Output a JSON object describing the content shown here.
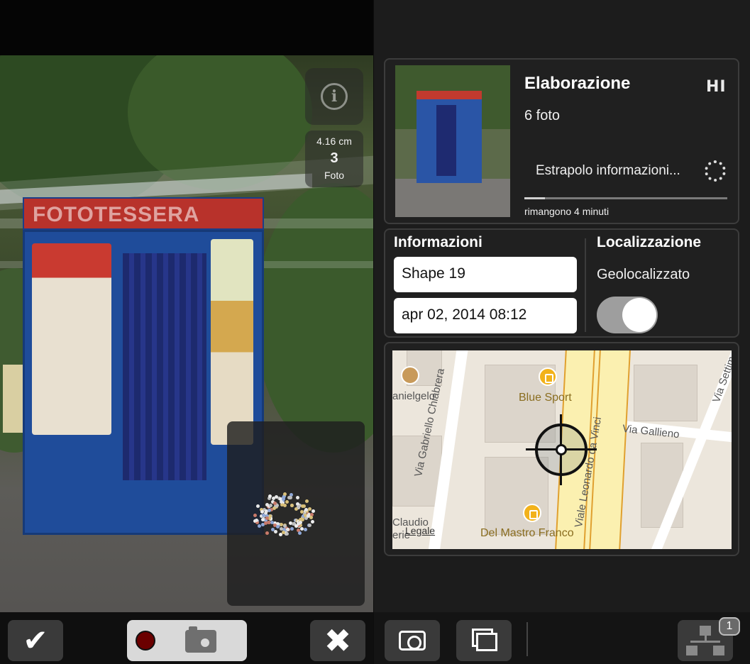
{
  "camera": {
    "measurement": {
      "distance": "4.16 cm",
      "count": "3",
      "unit_label": "Foto"
    },
    "scene_sign_text": "FOTOTESSERA",
    "toolbar": {
      "confirm_glyph": "✔",
      "cancel_glyph": "✖"
    }
  },
  "processing": {
    "title": "Elaborazione",
    "hi_res_label": "HI",
    "photo_count": "6 foto",
    "status": "Estrapolo informazioni...",
    "progress_fraction": 0.1,
    "time_remaining": "rimangono 4 minuti"
  },
  "info": {
    "heading": "Informazioni",
    "name_value": "Shape 19",
    "date_value": "apr 02, 2014 08:12"
  },
  "location": {
    "heading": "Localizzazione",
    "geo_label": "Geolocalizzato",
    "geolocated": true
  },
  "map": {
    "street_labels": [
      "anielgelo",
      "Via Gabriello Chiabrera",
      "Viale Leonardo da Vinci",
      "Via Gallieno",
      "Via Settim",
      "Claudio",
      "erie"
    ],
    "poi_labels": [
      "Blue Sport",
      "Del Mastro Franco"
    ],
    "legal_link": "Legale"
  },
  "bottom_toolbar": {
    "badge_count": "1"
  },
  "colors": {
    "panel_bg": "#1c1c1c",
    "card_border": "#3c3c3c",
    "poi_accent": "#f2b21b",
    "road_yellow": "#fbf0b0",
    "record_red": "#6b0000"
  },
  "icons": [
    "info-icon",
    "checkmark-icon",
    "record-icon",
    "camera-icon",
    "close-icon",
    "hi-res-icon",
    "spinner-icon",
    "restaurant-icon",
    "shopping-bag-icon",
    "crosshair-icon",
    "gallery-icon",
    "hierarchy-icon"
  ]
}
